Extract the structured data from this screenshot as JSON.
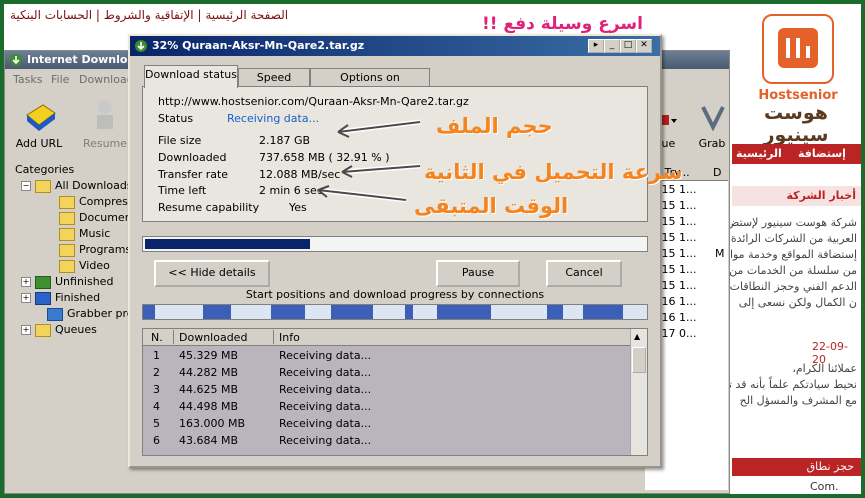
{
  "website": {
    "top_links": "الصفحة الرئيسية | الإتفاقية والشروط | الحسابات البنكية",
    "slogan": "اسرع وسيلة دفع !!",
    "brand": "Hostsenior",
    "brand_arabic": "هوست سينيور",
    "nav": [
      "الرئيسية",
      "إستضافة"
    ],
    "news_title": "أخبار الشركة",
    "body_lines": [
      "شركة هوست سينيور لإستض",
      "العربية من الشركات الرائدة في",
      "إستضافة المواقع وخدمة مواقع",
      "من سلسلة من الخدمات من",
      "الدعم الفني وحجز النطاقات",
      "ن الكمال ولكن نسعى إلى"
    ],
    "date": "22-09-20",
    "greeting_lines": [
      "عملائنا الكرام،",
      "نحيط سيادتكم علماً بأنه قد تم",
      "مع المشرف والمسؤل الح"
    ],
    "footer_text": "حجز نطاق",
    "footer_domain": "Com."
  },
  "idm": {
    "title": "Internet Downlo",
    "menu": [
      "Tasks",
      "File",
      "Download"
    ],
    "toolbar": {
      "add_url": "Add URL",
      "resume": "Resume",
      "queue": "eue",
      "grab": "Grab"
    },
    "categories_header": "Categories",
    "tree": {
      "all_downloads": "All Downloads",
      "compressed": "Compresse",
      "documents": "Documents",
      "music": "Music",
      "programs": "Programs",
      "video": "Video",
      "unfinished": "Unfinished",
      "finished": "Finished",
      "grabber": "Grabber projec",
      "queues": "Queues"
    },
    "list_header": {
      "last_try": "st Try...",
      "d": "D"
    },
    "list_rows": [
      {
        "last_try": "n 15 1..."
      },
      {
        "last_try": "n 15 1..."
      },
      {
        "last_try": "n 15 1..."
      },
      {
        "last_try": "n 15 1..."
      },
      {
        "last_try": "n 15 1...",
        "d": "M"
      },
      {
        "last_try": "n 15 1..."
      },
      {
        "last_try": "n 15 1..."
      },
      {
        "last_try": "n 16 1..."
      },
      {
        "last_try": "n 16 1..."
      },
      {
        "last_try": "n 17 0..."
      }
    ]
  },
  "dialog": {
    "title": "32% Quraan-Aksr-Mn-Qare2.tar.gz",
    "tabs": [
      "Download status",
      "Speed Limiter",
      "Options on completion"
    ],
    "url": "http://www.hostsenior.com/Quraan-Aksr-Mn-Qare2.tar.gz",
    "status_label": "Status",
    "status_value": "Receiving data...",
    "fields": [
      {
        "label": "File size",
        "value": "2.187  GB"
      },
      {
        "label": "Downloaded",
        "value": "737.658  MB  ( 32.91 % )"
      },
      {
        "label": "Transfer rate",
        "value": "12.088  MB/sec"
      },
      {
        "label": "Time left",
        "value": "2 min 6 sec"
      },
      {
        "label": "Resume capability",
        "value": "Yes"
      }
    ],
    "progress_fraction": 0.3291,
    "buttons": {
      "hide_details": "<< Hide details",
      "pause": "Pause",
      "cancel": "Cancel"
    },
    "connections_caption": "Start positions and download progress by connections",
    "table_headers": [
      "N.",
      "Downloaded",
      "Info"
    ],
    "connections": [
      {
        "n": "1",
        "downloaded": "45.329  MB",
        "info": "Receiving data..."
      },
      {
        "n": "2",
        "downloaded": "44.282  MB",
        "info": "Receiving data..."
      },
      {
        "n": "3",
        "downloaded": "44.625  MB",
        "info": "Receiving data..."
      },
      {
        "n": "4",
        "downloaded": "44.498  MB",
        "info": "Receiving data..."
      },
      {
        "n": "5",
        "downloaded": "163.000  MB",
        "info": "Receiving data..."
      },
      {
        "n": "6",
        "downloaded": "43.684  MB",
        "info": "Receiving data..."
      }
    ]
  },
  "annotations": {
    "file_size": "حجم الملف",
    "transfer_rate": "سرعة التحميل في الثانية",
    "time_left": "الوقت المتبقى"
  },
  "colors": {
    "accent_orange": "#f5841f",
    "site_red": "#bb2424",
    "idm_blue": "#0a246a"
  }
}
